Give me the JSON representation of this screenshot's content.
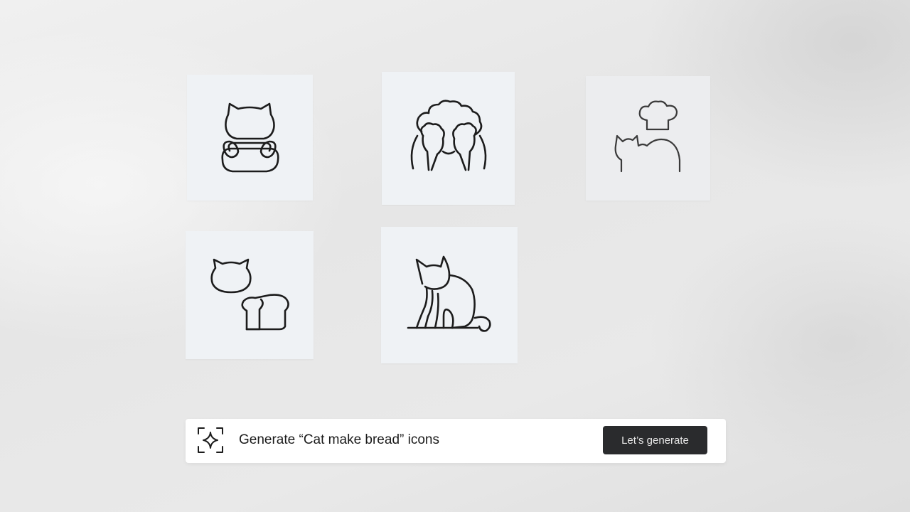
{
  "icon_grid": {
    "tiles": [
      {
        "icon": "cat-kneading-dough-icon"
      },
      {
        "icon": "cat-covering-eyes-icon"
      },
      {
        "icon": "cat-with-chef-hat-icon"
      },
      {
        "icon": "cat-head-and-bread-loaf-icon"
      },
      {
        "icon": "sitting-cat-icon"
      }
    ]
  },
  "prompt_bar": {
    "icon": "sparkle-scan-icon",
    "text": "Generate “Cat make bread” icons",
    "button_label": "Let’s generate"
  },
  "colors": {
    "tile_background": "#eff2f5",
    "button_background": "#2a2b2d",
    "stroke": "#1c1c1c"
  }
}
